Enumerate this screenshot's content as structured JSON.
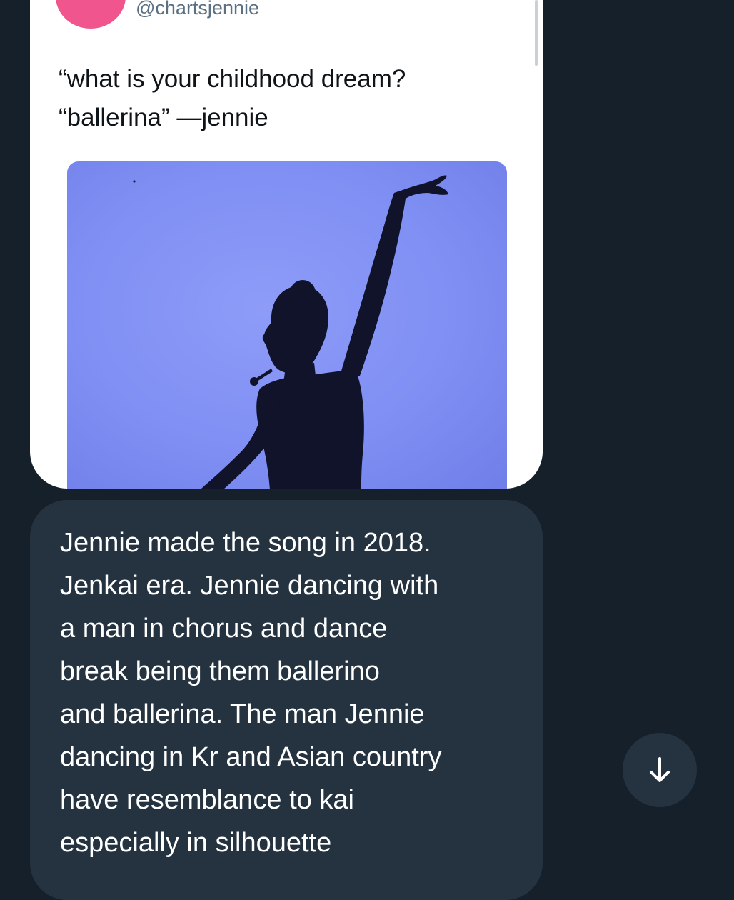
{
  "quoted_tweet": {
    "handle": "@chartsjennie",
    "text_lines": [
      "“what is your childhood dream?",
      "“ballerina” —jennie"
    ],
    "media": {
      "icon": "silhouette-dancer-image"
    }
  },
  "reply": {
    "lines": [
      "Jennie made the song in 2018.",
      "Jenkai era. Jennie dancing with",
      "a man in chorus and dance",
      "break being them ballerino",
      "and ballerina. The man Jennie",
      "dancing in Kr and Asian country",
      "have resemblance to kai",
      "especially in silhouette"
    ]
  },
  "scroll_button": {
    "icon": "arrow-down-icon"
  },
  "colors": {
    "background": "#15202b",
    "bubble": "#253341",
    "avatar": "#f0558e",
    "media_bg": "#7f8ff3"
  }
}
